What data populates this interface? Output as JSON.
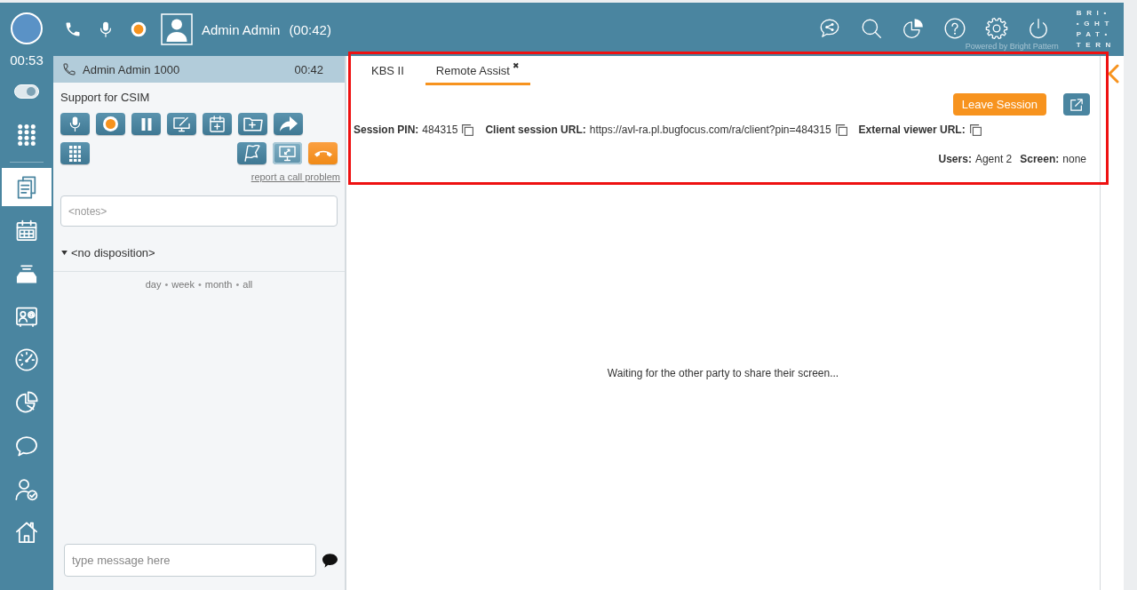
{
  "rail": {
    "timer": "00:53",
    "status_switch": {
      "on": true
    },
    "nav": [
      {
        "selected": true
      },
      {
        "selected": false
      },
      {
        "selected": false
      },
      {
        "selected": false
      },
      {
        "selected": false
      },
      {
        "selected": false
      },
      {
        "selected": false
      },
      {
        "selected": false
      },
      {
        "selected": false
      }
    ]
  },
  "top_bar": {
    "agent_name": "Admin Admin",
    "call_time": "(00:42)",
    "powered_by": "Powered by Bright Pattern",
    "logo_lines": [
      "BRI•",
      "•GHT",
      "PAT•",
      "TERN"
    ]
  },
  "call_panel": {
    "caller": "Admin Admin 1000",
    "duration": "00:42",
    "service": "Support for CSIM",
    "buttons": [
      [
        {
          "active": false
        },
        {
          "active": false
        },
        {
          "active": false
        },
        {
          "active": false
        },
        {
          "active": false
        },
        {
          "active": false
        },
        {
          "active": false
        }
      ],
      [
        {
          "active": false
        },
        {
          "active": false
        },
        {
          "active": true
        },
        {
          "active": false
        }
      ]
    ],
    "report_link": "report a call problem",
    "notes": {
      "placeholder": "<notes>"
    },
    "disposition": "<no disposition>",
    "history_filters": [
      {
        "label": "day"
      },
      {
        "label": "week"
      },
      {
        "label": "month"
      },
      {
        "label": "all"
      }
    ],
    "separators": [
      "•",
      "•",
      "•"
    ],
    "message": {
      "placeholder": "type message here"
    }
  },
  "workspace": {
    "tabs": [
      {
        "label": "KBS II",
        "selected": false
      },
      {
        "label": "Remote Assist",
        "selected": true,
        "close": "✖"
      }
    ],
    "leave_button": "Leave Session",
    "session_fields": [
      {
        "label": "Session PIN:",
        "value": "484315"
      },
      {
        "label": "Client session URL:",
        "value": "https://avl-ra.pl.bugfocus.com/ra/client?pin=484315"
      },
      {
        "label": "External viewer URL:"
      }
    ],
    "status": [
      {
        "label": "Users:",
        "value": "Agent 2"
      },
      {
        "label": "Screen:",
        "value": "none"
      }
    ],
    "waiting_message": "Waiting for the other party to share their screen..."
  }
}
